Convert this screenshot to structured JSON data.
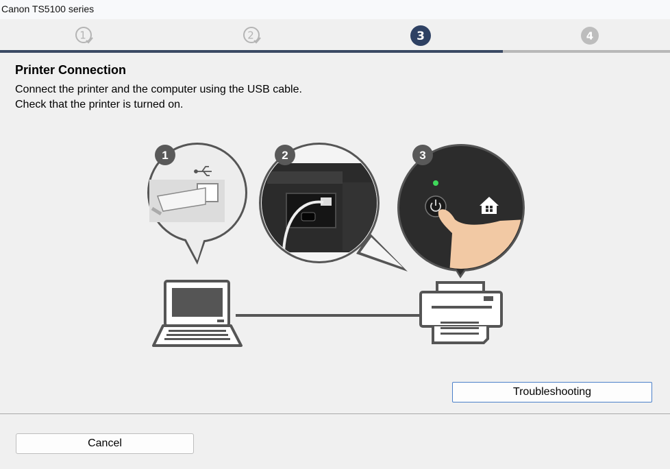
{
  "window": {
    "title": "Canon TS5100 series"
  },
  "steps": [
    {
      "number": "1",
      "state": "completed"
    },
    {
      "number": "2",
      "state": "completed"
    },
    {
      "number": "3",
      "state": "current"
    },
    {
      "number": "4",
      "state": "upcoming"
    }
  ],
  "progress": {
    "fraction": 0.75
  },
  "content": {
    "title": "Printer Connection",
    "line1": "Connect the printer and the computer using the USB cable.",
    "line2": "Check that the printer is turned on."
  },
  "illustration": {
    "callout1": "1",
    "callout2": "2",
    "callout3": "3"
  },
  "buttons": {
    "troubleshooting": "Troubleshooting",
    "cancel": "Cancel"
  },
  "colors": {
    "active_step": "#2e4163",
    "progress": "#3a4a64",
    "inactive": "#b8b8b8",
    "button_border": "#4a7fc9"
  }
}
